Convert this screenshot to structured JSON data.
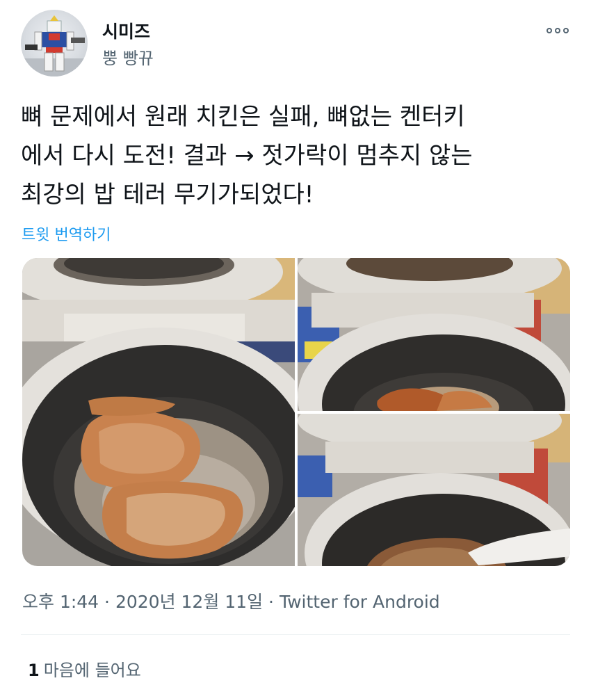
{
  "user": {
    "display_name": "시미즈",
    "handle": "뿡 빵뀨",
    "avatar_icon": "gundam-figure-avatar"
  },
  "tweet": {
    "text": "뼈 문제에서 원래 치킨은 실패, 뼈없는 켄터키\n에서 다시 도전! 결과 → 젓가락이 멈추지 않는\n최강의 밥 테러 무기가되었다!",
    "translate_label": "트윗 번역하기"
  },
  "media": {
    "photos": [
      "rice-cooker-chicken-photo-1",
      "rice-cooker-chicken-photo-2",
      "rice-cooker-chicken-photo-3"
    ]
  },
  "meta": {
    "time": "오후 1:44",
    "date": "2020년 12월 11일",
    "source": "Twitter for Android"
  },
  "stats": {
    "likes_count": "1",
    "likes_label": "마음에 들어요"
  },
  "colors": {
    "link": "#1d9bf0",
    "secondary_text": "#536471",
    "primary_text": "#0f1419"
  }
}
